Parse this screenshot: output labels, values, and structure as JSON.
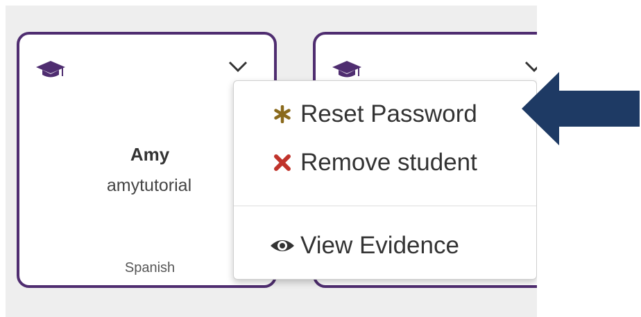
{
  "students": [
    {
      "name": "Amy",
      "username": "amytutorial",
      "course": "Spanish"
    }
  ],
  "menu": {
    "reset_password": "Reset Password",
    "remove_student": "Remove student",
    "view_evidence": "View Evidence"
  },
  "icons": {
    "card_icon": "graduation-cap-icon",
    "dropdown_icon": "chevron-down-icon",
    "reset_icon": "asterisk-icon",
    "remove_icon": "x-icon",
    "evidence_icon": "eye-icon"
  },
  "colors": {
    "card_border": "#4f2d70",
    "reset_icon": "#8a6a1c",
    "remove_icon": "#c0332b",
    "arrow": "#1e3a64",
    "panel_bg": "#eeeeee"
  }
}
